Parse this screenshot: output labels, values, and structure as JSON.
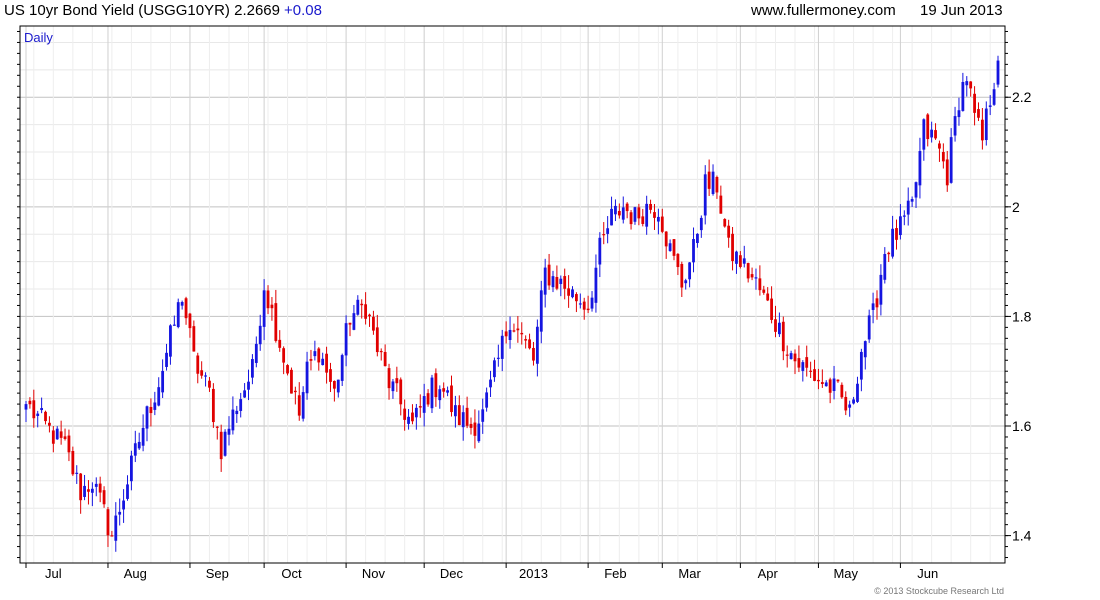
{
  "header": {
    "instrument": "US 10yr Bond Yield (USGG10YR)",
    "price": "2.2669",
    "change": "+0.08",
    "site": "www.fullermoney.com",
    "date": "19 Jun 2013"
  },
  "footer": {
    "copyright": "© 2013 Stockcube Research Ltd"
  },
  "colors": {
    "up": "#1515e0",
    "down": "#e00000",
    "grid": "#d4d4d4",
    "axis": "#000000",
    "period": "#1a1acc"
  },
  "chart_data": {
    "type": "candlestick",
    "period_label": "Daily",
    "ylim": [
      1.35,
      2.33
    ],
    "yticks": [
      1.4,
      1.6,
      1.8,
      2,
      2.2
    ],
    "ytick_labels": [
      "1.4",
      "1.6",
      "1.8",
      "2",
      "2.2"
    ],
    "y_axis_side": "right",
    "grid": true,
    "x_range": [
      0,
      249
    ],
    "xticks": [
      {
        "label": "Jul",
        "pos": 7
      },
      {
        "label": "Aug",
        "pos": 28
      },
      {
        "label": "Sep",
        "pos": 49
      },
      {
        "label": "Oct",
        "pos": 68
      },
      {
        "label": "Nov",
        "pos": 89
      },
      {
        "label": "Dec",
        "pos": 109
      },
      {
        "label": "2013",
        "pos": 130
      },
      {
        "label": "Feb",
        "pos": 151
      },
      {
        "label": "Mar",
        "pos": 170
      },
      {
        "label": "Apr",
        "pos": 190
      },
      {
        "label": "May",
        "pos": 210
      },
      {
        "label": "Jun",
        "pos": 231
      }
    ],
    "close_anchors": [
      [
        0,
        1.64
      ],
      [
        5,
        1.6
      ],
      [
        10,
        1.56
      ],
      [
        14,
        1.48
      ],
      [
        17,
        1.5
      ],
      [
        22,
        1.4
      ],
      [
        26,
        1.5
      ],
      [
        30,
        1.6
      ],
      [
        34,
        1.68
      ],
      [
        37,
        1.76
      ],
      [
        40,
        1.84
      ],
      [
        43,
        1.72
      ],
      [
        47,
        1.66
      ],
      [
        50,
        1.56
      ],
      [
        54,
        1.64
      ],
      [
        58,
        1.7
      ],
      [
        61,
        1.86
      ],
      [
        64,
        1.78
      ],
      [
        67,
        1.7
      ],
      [
        70,
        1.62
      ],
      [
        72,
        1.7
      ],
      [
        75,
        1.74
      ],
      [
        79,
        1.66
      ],
      [
        83,
        1.8
      ],
      [
        87,
        1.82
      ],
      [
        90,
        1.74
      ],
      [
        93,
        1.68
      ],
      [
        96,
        1.64
      ],
      [
        99,
        1.6
      ],
      [
        103,
        1.66
      ],
      [
        106,
        1.68
      ],
      [
        110,
        1.62
      ],
      [
        114,
        1.6
      ],
      [
        117,
        1.62
      ],
      [
        121,
        1.72
      ],
      [
        124,
        1.8
      ],
      [
        127,
        1.76
      ],
      [
        130,
        1.72
      ],
      [
        133,
        1.88
      ],
      [
        137,
        1.86
      ],
      [
        140,
        1.84
      ],
      [
        144,
        1.82
      ],
      [
        147,
        1.92
      ],
      [
        150,
        1.98
      ],
      [
        153,
        2.0
      ],
      [
        156,
        1.98
      ],
      [
        159,
        2.0
      ],
      [
        162,
        2.0
      ],
      [
        165,
        1.92
      ],
      [
        168,
        1.86
      ],
      [
        171,
        1.92
      ],
      [
        174,
        2.04
      ],
      [
        177,
        2.04
      ],
      [
        180,
        1.92
      ],
      [
        183,
        1.9
      ],
      [
        187,
        1.86
      ],
      [
        190,
        1.82
      ],
      [
        194,
        1.76
      ],
      [
        197,
        1.72
      ],
      [
        200,
        1.7
      ],
      [
        204,
        1.68
      ],
      [
        208,
        1.66
      ],
      [
        211,
        1.62
      ],
      [
        214,
        1.74
      ],
      [
        217,
        1.8
      ],
      [
        220,
        1.92
      ],
      [
        224,
        1.96
      ],
      [
        227,
        2.0
      ],
      [
        230,
        2.14
      ],
      [
        233,
        2.12
      ],
      [
        236,
        2.06
      ],
      [
        239,
        2.2
      ],
      [
        241,
        2.24
      ],
      [
        243,
        2.16
      ],
      [
        245,
        2.12
      ],
      [
        247,
        2.2
      ],
      [
        249,
        2.2669
      ]
    ]
  }
}
